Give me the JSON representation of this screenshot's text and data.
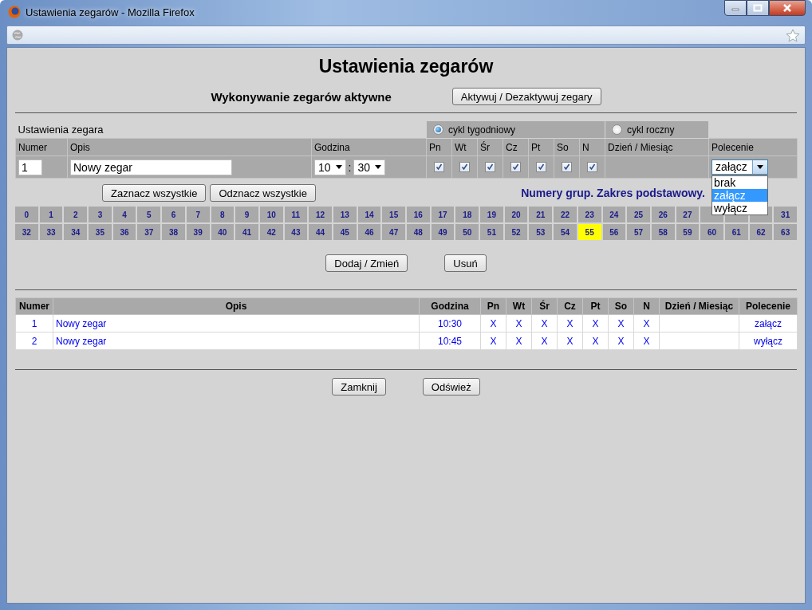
{
  "window": {
    "title": "Ustawienia zegarów - Mozilla Firefox"
  },
  "heading": "Ustawienia zegarów",
  "status": {
    "text": "Wykonywanie zegarów aktywne",
    "button": "Aktywuj / Dezaktywuj zegary"
  },
  "form": {
    "title": "Ustawienia zegara",
    "cycles": [
      {
        "label": "cykl tygodniowy",
        "selected": true
      },
      {
        "label": "cykl roczny",
        "selected": false
      }
    ],
    "columns": [
      "Numer",
      "Opis",
      "Godzina",
      "Pn",
      "Wt",
      "Śr",
      "Cz",
      "Pt",
      "So",
      "N",
      "Dzień / Miesiąc",
      "Polecenie"
    ],
    "number": "1",
    "description": "Nowy zegar",
    "hour": "10",
    "separator": ":",
    "minute": "30",
    "days": [
      {
        "checked": true
      },
      {
        "checked": true
      },
      {
        "checked": true
      },
      {
        "checked": true
      },
      {
        "checked": true
      },
      {
        "checked": true
      },
      {
        "checked": true
      }
    ],
    "command": {
      "value": "załącz",
      "expanded": true,
      "options": [
        {
          "label": "brak",
          "selected": false
        },
        {
          "label": "załącz",
          "selected": true
        },
        {
          "label": "wyłącz",
          "selected": false
        }
      ]
    }
  },
  "group_buttons": [
    "Zaznacz wszystkie",
    "Odznacz wszystkie"
  ],
  "groups_caption": "Numery grup. Zakres podstawowy.",
  "groups": [
    {
      "label": "0",
      "selected": false
    },
    {
      "label": "1",
      "selected": false
    },
    {
      "label": "2",
      "selected": false
    },
    {
      "label": "3",
      "selected": false
    },
    {
      "label": "4",
      "selected": false
    },
    {
      "label": "5",
      "selected": false
    },
    {
      "label": "6",
      "selected": false
    },
    {
      "label": "7",
      "selected": false
    },
    {
      "label": "8",
      "selected": false
    },
    {
      "label": "9",
      "selected": false
    },
    {
      "label": "10",
      "selected": false
    },
    {
      "label": "11",
      "selected": false
    },
    {
      "label": "12",
      "selected": false
    },
    {
      "label": "13",
      "selected": false
    },
    {
      "label": "14",
      "selected": false
    },
    {
      "label": "15",
      "selected": false
    },
    {
      "label": "16",
      "selected": false
    },
    {
      "label": "17",
      "selected": false
    },
    {
      "label": "18",
      "selected": false
    },
    {
      "label": "19",
      "selected": false
    },
    {
      "label": "20",
      "selected": false
    },
    {
      "label": "21",
      "selected": false
    },
    {
      "label": "22",
      "selected": false
    },
    {
      "label": "23",
      "selected": false
    },
    {
      "label": "24",
      "selected": false
    },
    {
      "label": "25",
      "selected": false
    },
    {
      "label": "26",
      "selected": false
    },
    {
      "label": "27",
      "selected": false
    },
    {
      "selected": false
    },
    {
      "selected": false
    },
    {
      "selected": false
    },
    {
      "label": "31",
      "selected": false
    },
    {
      "label": "32",
      "selected": false
    },
    {
      "label": "33",
      "selected": false
    },
    {
      "label": "34",
      "selected": false
    },
    {
      "label": "35",
      "selected": false
    },
    {
      "label": "36",
      "selected": false
    },
    {
      "label": "37",
      "selected": false
    },
    {
      "label": "38",
      "selected": false
    },
    {
      "label": "39",
      "selected": false
    },
    {
      "label": "40",
      "selected": false
    },
    {
      "label": "41",
      "selected": false
    },
    {
      "label": "42",
      "selected": false
    },
    {
      "label": "43",
      "selected": false
    },
    {
      "label": "44",
      "selected": false
    },
    {
      "label": "45",
      "selected": false
    },
    {
      "label": "46",
      "selected": false
    },
    {
      "label": "47",
      "selected": false
    },
    {
      "label": "48",
      "selected": false
    },
    {
      "label": "49",
      "selected": false
    },
    {
      "label": "50",
      "selected": false
    },
    {
      "label": "51",
      "selected": false
    },
    {
      "label": "52",
      "selected": false
    },
    {
      "label": "53",
      "selected": false
    },
    {
      "label": "54",
      "selected": false
    },
    {
      "label": "55",
      "selected": true
    },
    {
      "label": "56",
      "selected": false
    },
    {
      "label": "57",
      "selected": false
    },
    {
      "label": "58",
      "selected": false
    },
    {
      "label": "59",
      "selected": false
    },
    {
      "label": "60",
      "selected": false
    },
    {
      "label": "61",
      "selected": false
    },
    {
      "label": "62",
      "selected": false
    },
    {
      "label": "63",
      "selected": false
    }
  ],
  "actions": [
    "Dodaj / Zmień",
    "Usuń"
  ],
  "table": {
    "columns": [
      "Numer",
      "Opis",
      "Godzina",
      "Pn",
      "Wt",
      "Śr",
      "Cz",
      "Pt",
      "So",
      "N",
      "Dzień / Miesiąc",
      "Polecenie"
    ],
    "rows": [
      [
        "1",
        "Nowy zegar",
        "10:30",
        "X",
        "X",
        "X",
        "X",
        "X",
        "X",
        "X",
        null,
        "załącz"
      ],
      [
        "2",
        "Nowy zegar",
        "10:45",
        "X",
        "X",
        "X",
        "X",
        "X",
        "X",
        "X",
        null,
        "wyłącz"
      ]
    ]
  },
  "footer_buttons": [
    "Zamknij",
    "Odśwież"
  ]
}
